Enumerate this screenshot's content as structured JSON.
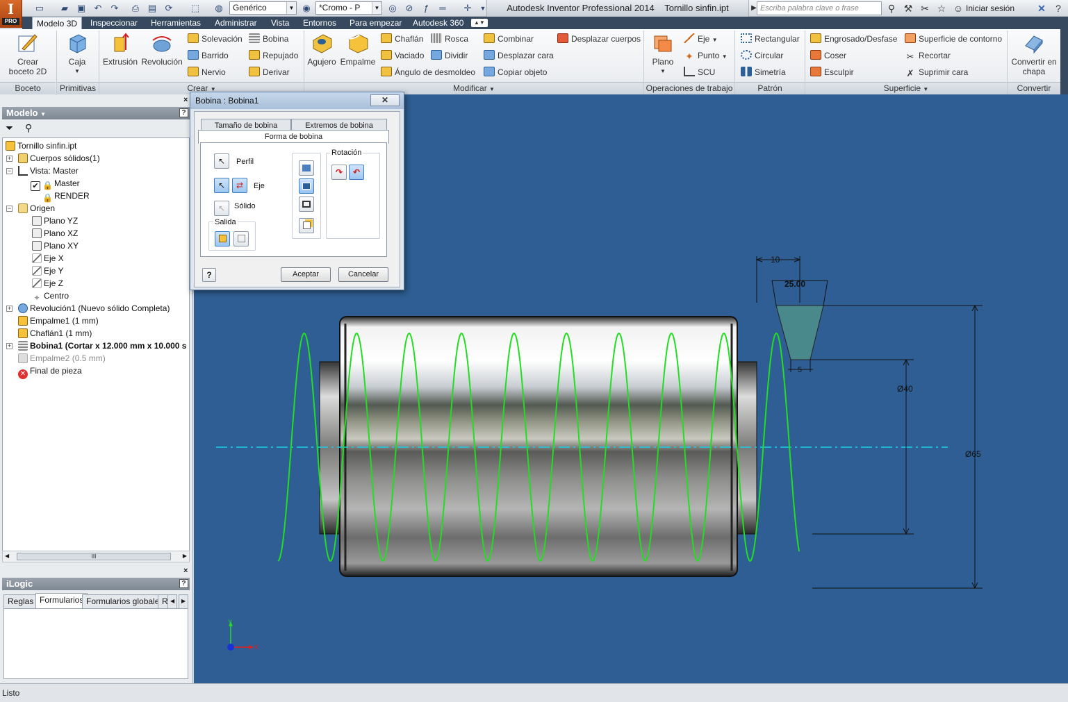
{
  "app": {
    "title": "Autodesk Inventor Professional 2014",
    "document": "Tornillo sinfin.ipt",
    "logo_letter": "I",
    "logo_badge": "PRO"
  },
  "quick_access": {
    "material": "Genérico",
    "appearance": "*Cromo - P",
    "search_placeholder": "Escriba palabra clave o frase",
    "sign_in": "Iniciar sesión"
  },
  "tabs": [
    "Modelo 3D",
    "Inspeccionar",
    "Herramientas",
    "Administrar",
    "Vista",
    "Entornos",
    "Para empezar",
    "Autodesk 360"
  ],
  "ribbon": {
    "boceto": {
      "big": "Crear\nboceto 2D",
      "label": "Boceto"
    },
    "primitivas": {
      "big": "Caja",
      "label": "Primitivas"
    },
    "crear": {
      "label": "Crear",
      "big": [
        "Extrusión",
        "Revolución"
      ],
      "small": [
        "Solevación",
        "Barrido",
        "Nervio",
        "Bobina",
        "Repujado",
        "Derivar"
      ]
    },
    "modificar": {
      "label": "Modificar",
      "big": [
        "Agujero",
        "Empalme"
      ],
      "small": [
        "Chaflán",
        "Vaciado",
        "Ángulo de desmoldeo",
        "Rosca",
        "Dividir",
        "Combinar",
        "Desplazar cara",
        "Copiar objeto",
        "Desplazar cuerpos"
      ]
    },
    "operaciones": {
      "label": "Operaciones de trabajo",
      "big": "Plano",
      "small": [
        "Eje",
        "Punto",
        "SCU"
      ]
    },
    "patron": {
      "label": "Patrón",
      "small": [
        "Rectangular",
        "Circular",
        "Simetría"
      ]
    },
    "superficie": {
      "label": "Superficie",
      "small": [
        "Engrosado/Desfase",
        "Coser",
        "Esculpir",
        "Superficie de contorno",
        "Recortar",
        "Suprimir cara"
      ]
    },
    "convertir": {
      "label": "Convertir",
      "big": "Convertir en\nchapa"
    }
  },
  "browser": {
    "title": "Modelo",
    "nodes": [
      "Tornillo sinfin.ipt",
      "Cuerpos sólidos(1)",
      "Vista: Master",
      "Master",
      "RENDER",
      "Origen",
      "Plano YZ",
      "Plano XZ",
      "Plano XY",
      "Eje X",
      "Eje Y",
      "Eje Z",
      "Centro",
      "Revolución1 (Nuevo sólido Completa)",
      "Empalme1 (1 mm)",
      "Chaflán1 (1 mm)",
      "Bobina1 (Cortar x 12.000 mm x 10.000 s",
      "Empalme2 (0.5 mm)",
      "Final de pieza"
    ],
    "scroll_grip": "III"
  },
  "ilogic": {
    "title": "iLogic",
    "tabs": [
      "Reglas",
      "Formularios",
      "Formularios globales",
      "R"
    ]
  },
  "dialog": {
    "title": "Bobina : Bobina1",
    "tabs": [
      "Tamaño de bobina",
      "Extremos de bobina",
      "Forma de bobina"
    ],
    "perfil": "Perfil",
    "eje": "Eje",
    "solido": "Sólido",
    "salida": "Salida",
    "rotacion": "Rotación",
    "ok": "Aceptar",
    "cancel": "Cancelar",
    "help": "?"
  },
  "viewport": {
    "dim_pitch": "10",
    "dim_top": "25.00",
    "dim_bottom": "5",
    "dim_d40": "Ø40",
    "dim_d65": "Ø65",
    "axis_x": "X",
    "axis_y": "Y"
  },
  "status": "Listo",
  "colors": {
    "viewport": "#2e5e93",
    "helix": "#22dd22",
    "centerline": "#1ad0e8",
    "accent_tab": "#36495f"
  }
}
